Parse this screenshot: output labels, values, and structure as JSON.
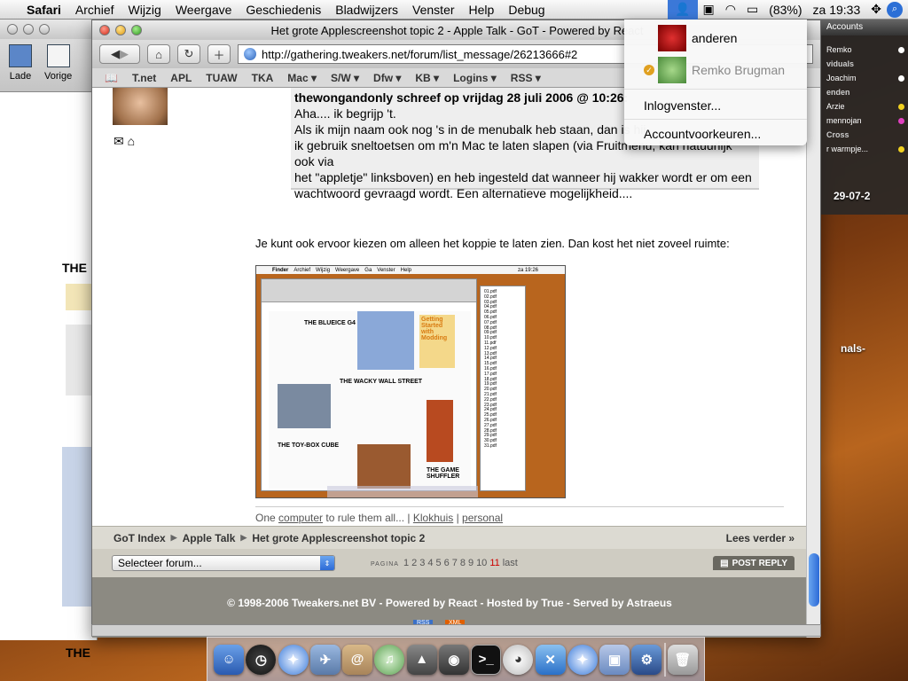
{
  "menubar": {
    "app": "Safari",
    "items": [
      "Archief",
      "Wijzig",
      "Weergave",
      "Geschiedenis",
      "Bladwijzers",
      "Venster",
      "Help",
      "Debug"
    ],
    "battery": "(83%)",
    "clock": "za 19:33"
  },
  "user_menu": {
    "users": [
      {
        "name": "anderen",
        "active": false
      },
      {
        "name": "Remko Brugman",
        "active": true
      }
    ],
    "login_window": "Inlogvenster...",
    "account_prefs": "Accountvoorkeuren..."
  },
  "back_window": {
    "toolbar": [
      "Lade",
      "Vorige"
    ],
    "heading_fragments": [
      "THE",
      "THE"
    ]
  },
  "window": {
    "title": "Het grote Applescreenshot topic 2 - Apple Talk - GoT - Powered by React",
    "url": "http://gathering.tweakers.net/forum/list_message/26213666#2",
    "bookmarks": [
      "T.net",
      "APL",
      "TUAW",
      "TKA",
      "Mac ▾",
      "S/W ▾",
      "Dfw ▾",
      "KB ▾",
      "Logins ▾",
      "RSS ▾"
    ]
  },
  "post": {
    "quote_author": "thewongandonly schreef op vrijdag 28 juli 2006 @ 10:26:",
    "quote_lines": [
      "Aha.... ik begrijp 't.",
      "Als ik mijn naam ook nog 's in de menubalk heb staan, dan is hij",
      "ik gebruik sneltoetsen om m'n Mac te laten slapen (via Fruitmenu, kan natuurlijk ook via",
      "het \"appletje\" linksboven) en heb ingesteld dat wanneer hij wakker wordt er om een",
      "wachtwoord gevraagd wordt. Een alternatieve mogelijkheid...."
    ],
    "body": "Je kunt ook ervoor kiezen om alleen het koppie te laten zien. Dan kost het niet zoveel ruimte:",
    "embedded": {
      "menubar": [
        "Finder",
        "Archief",
        "Wijzig",
        "Weergave",
        "Ga",
        "Venster",
        "Help"
      ],
      "clock": "za 19:26",
      "headlines": [
        "THE BLUEICE G4",
        "Getting Started with Modding",
        "THE WACKY WALL STREET",
        "THE TOY-BOX CUBE",
        "THE GAME SHUFFLER"
      ],
      "files": [
        "01.pdf",
        "02.pdf",
        "03.pdf",
        "04.pdf",
        "05.pdf",
        "06.pdf",
        "07.pdf",
        "08.pdf",
        "09.pdf",
        "10.pdf",
        "11.pdf",
        "12.pdf",
        "13.pdf",
        "14.pdf",
        "15.pdf",
        "16.pdf",
        "17.pdf",
        "18.pdf",
        "19.pdf",
        "20.pdf",
        "21.pdf",
        "22.pdf",
        "23.pdf",
        "24.pdf",
        "25.pdf",
        "26.pdf",
        "27.pdf",
        "28.pdf",
        "29.pdf",
        "30.pdf",
        "31.pdf"
      ]
    },
    "signature": {
      "prefix": "One ",
      "link1": "computer",
      "middle": " to rule them all... | ",
      "link2": "Klokhuis",
      "sep": " | ",
      "link3": "personal"
    }
  },
  "forum_footer": {
    "breadcrumb": [
      "GoT Index",
      "Apple Talk",
      "Het grote Applescreenshot topic 2"
    ],
    "more": "Lees verder »",
    "select": "Selecteer forum...",
    "pager_label": "PAGINA",
    "pages": [
      "1",
      "2",
      "3",
      "4",
      "5",
      "6",
      "7",
      "8",
      "9",
      "10",
      "11"
    ],
    "current_page": "11",
    "last": "last",
    "reply": "POST REPLY",
    "copyright": "© 1998-2006 Tweakers.net BV - Powered by React - Hosted by True - Served by Astraeus",
    "badges": [
      "RSS",
      "XML"
    ]
  },
  "contacts": {
    "header": "Accounts",
    "rows": [
      {
        "name": "Remko",
        "kind": "contact",
        "status": "#ffffff"
      },
      {
        "name": "viduals",
        "kind": "group"
      },
      {
        "name": "Joachim",
        "kind": "contact",
        "status": "#ffffff"
      },
      {
        "name": "enden",
        "kind": "group"
      },
      {
        "name": "Arzie",
        "kind": "contact",
        "status": "#f0d020"
      },
      {
        "name": "mennojan",
        "kind": "contact",
        "status": "#e040c0"
      },
      {
        "name": "Cross",
        "kind": "group"
      },
      {
        "name": "r warmpje...",
        "kind": "contact",
        "status": "#f0d020"
      }
    ]
  },
  "desktop": {
    "date_label": "29-07-2",
    "side_label": "nals-"
  },
  "dock_icons": [
    "finder-icon",
    "dashboard-icon",
    "safari-icon",
    "mail-icon",
    "address-book-icon",
    "itunes-icon",
    "iphoto-icon",
    "terminal-icon",
    "adium-icon",
    "xcode-icon",
    "safari2-icon",
    "preview-icon",
    "automator-icon",
    "trash-icon"
  ]
}
